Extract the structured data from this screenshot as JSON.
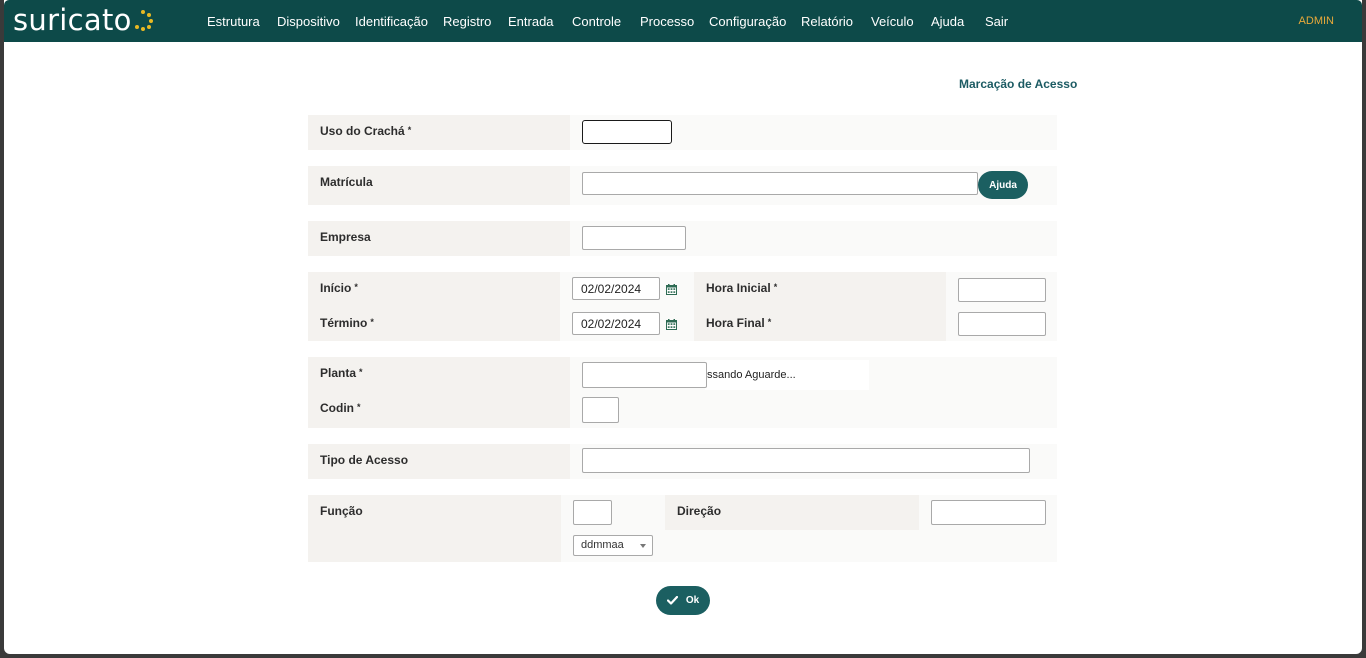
{
  "brand": {
    "name": "suricato"
  },
  "nav": {
    "items": [
      "Estrutura",
      "Dispositivo",
      "Identificação",
      "Registro",
      "Entrada",
      "Controle",
      "Processo",
      "Configuração",
      "Relatório",
      "Veículo",
      "Ajuda",
      "Sair"
    ],
    "user": "ADMIN"
  },
  "page": {
    "title": "Marcação de Acesso"
  },
  "form": {
    "uso_cracha": {
      "label": "Uso do Crachá",
      "value": ""
    },
    "matricula": {
      "label": "Matrícula",
      "value": "",
      "help_button": "Ajuda"
    },
    "empresa": {
      "label": "Empresa",
      "value": ""
    },
    "inicio": {
      "label": "Início",
      "value": "02/02/2024"
    },
    "termino": {
      "label": "Término",
      "value": "02/02/2024"
    },
    "hora_inicial": {
      "label": "Hora Inicial",
      "value": ""
    },
    "hora_final": {
      "label": "Hora Final",
      "value": ""
    },
    "planta": {
      "label": "Planta",
      "value": "",
      "status": "ssando Aguarde..."
    },
    "codin": {
      "label": "Codin",
      "value": ""
    },
    "tipo_acesso": {
      "label": "Tipo de Acesso",
      "value": ""
    },
    "funcao": {
      "label": "Função",
      "value": "",
      "format_selected": "ddmmaa"
    },
    "direcao": {
      "label": "Direção",
      "value": ""
    },
    "required_marker": "*",
    "ok_button": "Ok"
  },
  "colors": {
    "topbar": "#0d4a49",
    "accent": "#1b5f61",
    "admin": "#e8a93a",
    "logo_dots": "#e8b923"
  }
}
